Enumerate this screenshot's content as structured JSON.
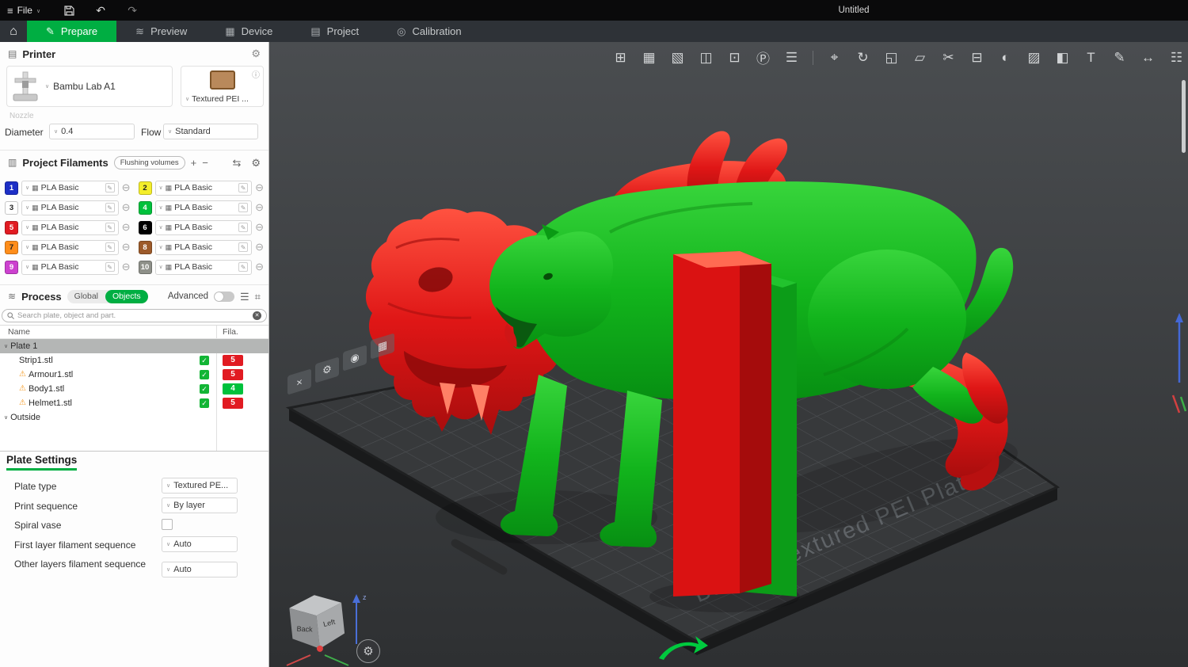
{
  "colors": {
    "accent": "#00AE42",
    "model_green": "#12B41C",
    "model_red": "#DF1616"
  },
  "icons": {
    "menu": "≡",
    "chevron": "∨",
    "undo": "↶",
    "redo": "↷",
    "home": "⌂",
    "prepare": "✎",
    "preview": "≋",
    "device": "▦",
    "project": "▤",
    "calibration": "◎",
    "gear": "⚙",
    "info": "ⓘ",
    "add": "+",
    "remove": "−",
    "sync": "⇆",
    "edit": "✎",
    "grid_small": "▦",
    "remove_circle": "⊖",
    "list": "☰",
    "tune": "⌗",
    "check": "✓",
    "warning": "⚠",
    "clear": "✕",
    "printer_section": "▤",
    "filament_section": "▥",
    "process_section": "≋",
    "camera": "⚙"
  },
  "titlebar": {
    "file_menu": "File",
    "title": "Untitled"
  },
  "tabs": {
    "prepare": "Prepare",
    "preview": "Preview",
    "device": "Device",
    "project": "Project",
    "calibration": "Calibration"
  },
  "printer": {
    "section_title": "Printer",
    "name": "Bambu Lab A1",
    "plate_type": "Textured PEI ...",
    "nozzle_label": "Nozzle",
    "diameter_label": "Diameter",
    "diameter_value": "0.4",
    "flow_label": "Flow",
    "flow_value": "Standard"
  },
  "filaments": {
    "section_title": "Project Filaments",
    "flushing_button": "Flushing volumes",
    "items": [
      {
        "num": "1",
        "bg": "#1D2FC6",
        "fg": "#FFFFFF",
        "name": "PLA Basic"
      },
      {
        "num": "2",
        "bg": "#F4EE2A",
        "fg": "#1F1F1F",
        "name": "PLA Basic"
      },
      {
        "num": "3",
        "bg": "#FFFFFF",
        "fg": "#1F1F1F",
        "name": "PLA Basic"
      },
      {
        "num": "4",
        "bg": "#00C13C",
        "fg": "#FFFFFF",
        "name": "PLA Basic"
      },
      {
        "num": "5",
        "bg": "#E11B22",
        "fg": "#FFFFFF",
        "name": "PLA Basic"
      },
      {
        "num": "6",
        "bg": "#000000",
        "fg": "#FFFFFF",
        "name": "PLA Basic"
      },
      {
        "num": "7",
        "bg": "#FF8D1A",
        "fg": "#1F1F1F",
        "name": "PLA Basic"
      },
      {
        "num": "8",
        "bg": "#9C5A2A",
        "fg": "#FFFFFF",
        "name": "PLA Basic"
      },
      {
        "num": "9",
        "bg": "#CC41CF",
        "fg": "#FFFFFF",
        "name": "PLA Basic"
      },
      {
        "num": "10",
        "bg": "#8E9089",
        "fg": "#FFFFFF",
        "name": "PLA Basic"
      }
    ]
  },
  "process": {
    "section_title": "Process",
    "scope_global": "Global",
    "scope_objects": "Objects",
    "advanced_label": "Advanced",
    "search_placeholder": "Search plate, object and part.",
    "columns": {
      "name": "Name",
      "fila": "Fila."
    },
    "tree": [
      {
        "label": "Plate 1"
      },
      {
        "label": "Strip1.stl",
        "fila": "5",
        "fila_bg": "#E11B22"
      },
      {
        "label": "Armour1.stl",
        "fila": "5",
        "fila_bg": "#E11B22"
      },
      {
        "label": "Body1.stl",
        "fila": "4",
        "fila_bg": "#00C13C"
      },
      {
        "label": "Helmet1.stl",
        "fila": "5",
        "fila_bg": "#E11B22"
      },
      {
        "label": "Outside"
      }
    ]
  },
  "plate_settings": {
    "title": "Plate Settings",
    "plate_type_label": "Plate type",
    "plate_type_value": "Textured PE...",
    "print_sequence_label": "Print sequence",
    "print_sequence_value": "By layer",
    "spiral_vase_label": "Spiral vase",
    "first_layer_label": "First layer filament sequence",
    "first_layer_value": "Auto",
    "other_layers_label": "Other layers filament sequence",
    "other_layers_value": "Auto"
  },
  "viewport": {
    "plate_label": "Bambu Textured PEI Plate",
    "toolbar": [
      {
        "name": "add-plate",
        "glyph": "⊞"
      },
      {
        "name": "arrange-all",
        "glyph": "▦"
      },
      {
        "name": "auto-orient",
        "glyph": "▧"
      },
      {
        "name": "split-to-plates",
        "glyph": "◫"
      },
      {
        "name": "copy",
        "glyph": "⊡"
      },
      {
        "name": "paste",
        "glyph": "Ⓟ"
      },
      {
        "name": "object-list",
        "glyph": "☰"
      },
      {
        "name": "move",
        "glyph": "⌖"
      },
      {
        "name": "rotate",
        "glyph": "↻"
      },
      {
        "name": "scale",
        "glyph": "◱"
      },
      {
        "name": "flatten",
        "glyph": "▱"
      },
      {
        "name": "cut",
        "glyph": "✂"
      },
      {
        "name": "align",
        "glyph": "⊟"
      },
      {
        "name": "mesh-boolean",
        "glyph": "◐"
      },
      {
        "name": "support-paint",
        "glyph": "▨"
      },
      {
        "name": "color-paint",
        "glyph": "◧"
      },
      {
        "name": "text",
        "glyph": "T"
      },
      {
        "name": "seam",
        "glyph": "✎"
      },
      {
        "name": "measure",
        "glyph": "↔"
      },
      {
        "name": "assembly",
        "glyph": "☷"
      }
    ],
    "plate_actions": [
      {
        "name": "plate-arrange",
        "glyph": "▦"
      },
      {
        "name": "plate-lock",
        "glyph": "◉"
      },
      {
        "name": "plate-settings",
        "glyph": "⚙"
      },
      {
        "name": "plate-delete",
        "glyph": "×"
      }
    ],
    "navcube": {
      "back": "Back",
      "left": "Left",
      "axis_z": "z"
    }
  }
}
